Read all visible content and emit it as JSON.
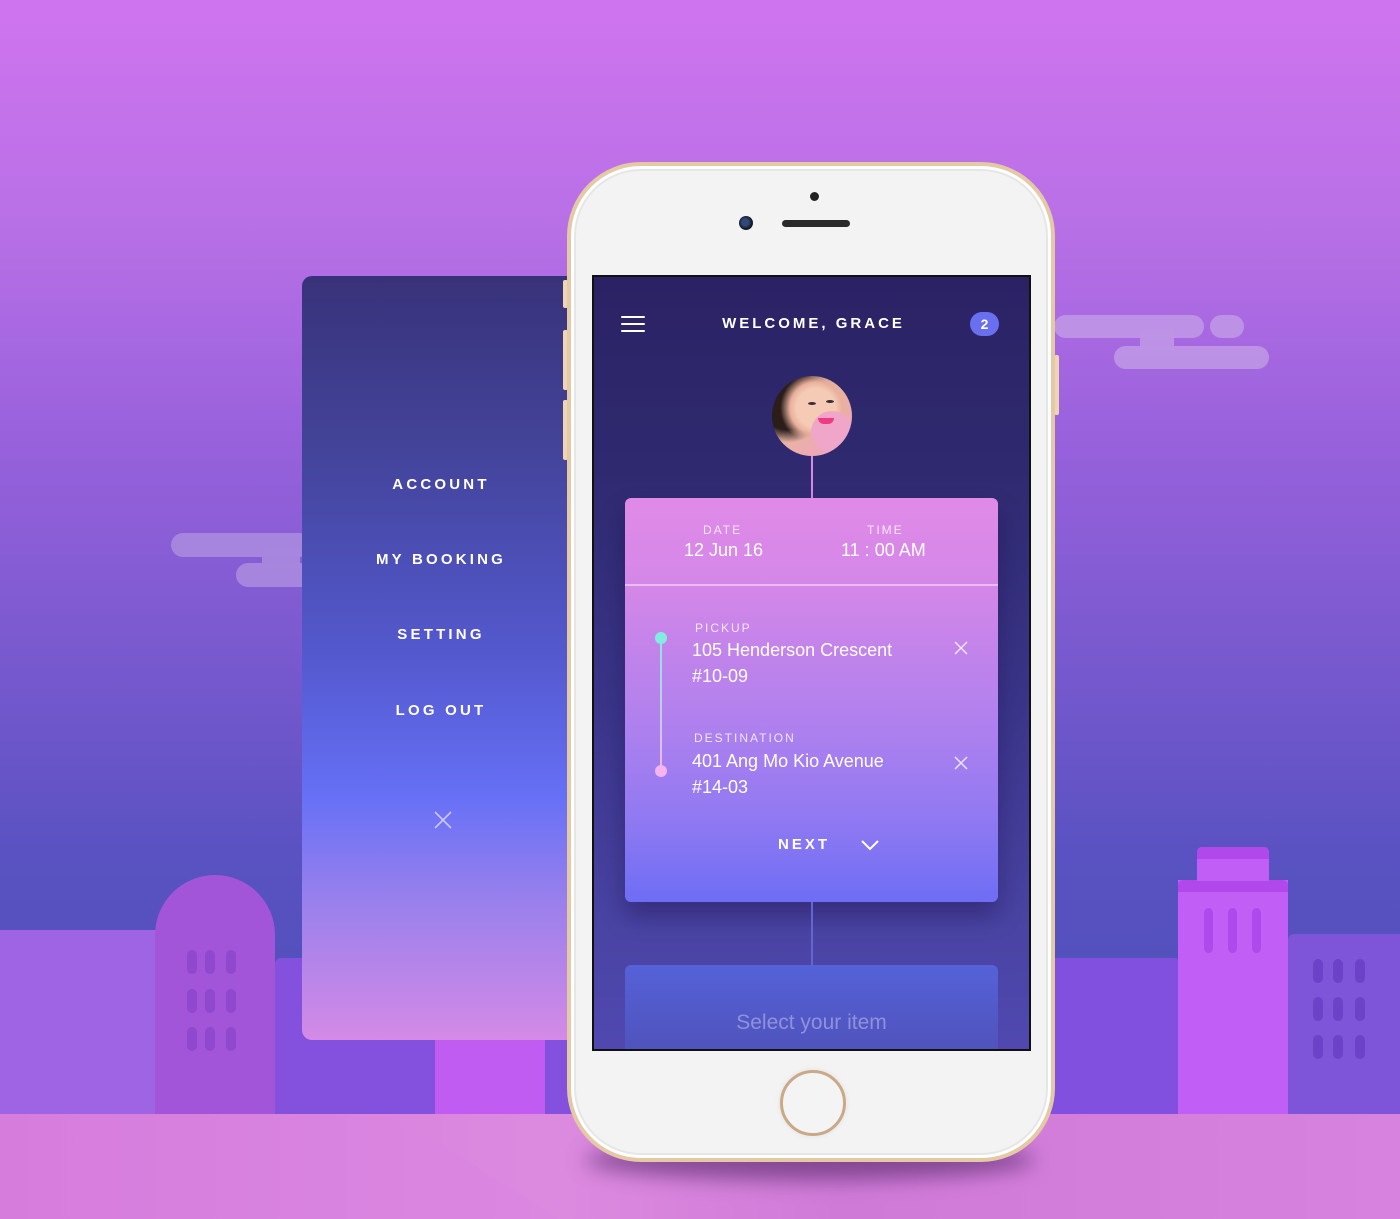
{
  "header": {
    "title": "WELCOME, GRACE",
    "notification_count": "2"
  },
  "side_menu": {
    "items": [
      {
        "label": "ACCOUNT"
      },
      {
        "label": "MY BOOKING"
      },
      {
        "label": "SETTING"
      },
      {
        "label": "LOG OUT"
      }
    ]
  },
  "booking": {
    "date_label": "DATE",
    "date_value": "12 Jun 16",
    "time_label": "TIME",
    "time_value": "11 : 00 AM",
    "pickup_label": "PICKUP",
    "pickup_line1": "105 Henderson Crescent",
    "pickup_line2": "#10-09",
    "destination_label": "DESTINATION",
    "destination_line1": "401 Ang Mo Kio Avenue",
    "destination_line2": "#14-03",
    "next_label": "NEXT"
  },
  "select_item": {
    "placeholder": "Select your item"
  },
  "colors": {
    "badge": "#6a6ff0",
    "pickup_dot": "#82ece0",
    "destination_dot": "#f5b4ee",
    "phone_frame": "#e3c9a4"
  }
}
